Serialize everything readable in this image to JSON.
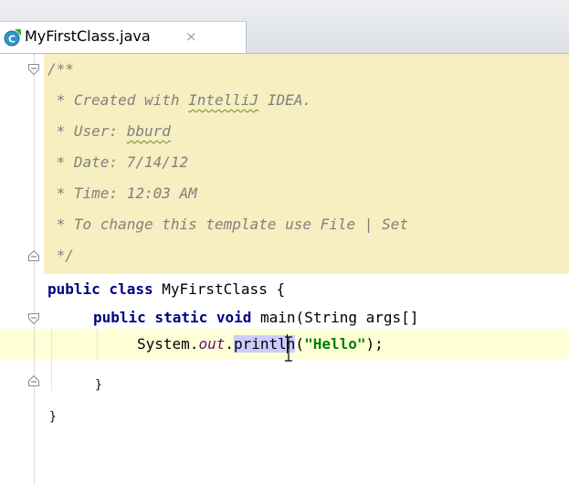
{
  "tab": {
    "title": "MyFirstClass.java",
    "close": "×",
    "icon": "java-class-icon"
  },
  "editor": {
    "doc_lines": [
      "/**",
      " * Created with ",
      "IntelliJ",
      " IDEA.",
      " * User: ",
      "bburd",
      " * Date: 7/14/12",
      " * Time: 12:03 AM",
      " * To change this template use File | Set",
      " */"
    ],
    "code": {
      "class_kw": "public class",
      "class_name": " MyFirstClass {",
      "method_kw": "public static void",
      "method_rest": " main(String args[]",
      "stmt_obj": "System.",
      "stmt_field": "out",
      "stmt_dot": ".",
      "stmt_method": "println",
      "stmt_open": "(",
      "stmt_str": "\"Hello\"",
      "stmt_close": ");",
      "close_method": "}",
      "close_class": "}"
    }
  },
  "colors": {
    "doc_background": "#f7eec1",
    "current_line": "#ffffd7",
    "keyword": "#000080",
    "string": "#008000",
    "field": "#660e7a",
    "comment": "#808080",
    "usage_highlight": "#ccccff"
  }
}
